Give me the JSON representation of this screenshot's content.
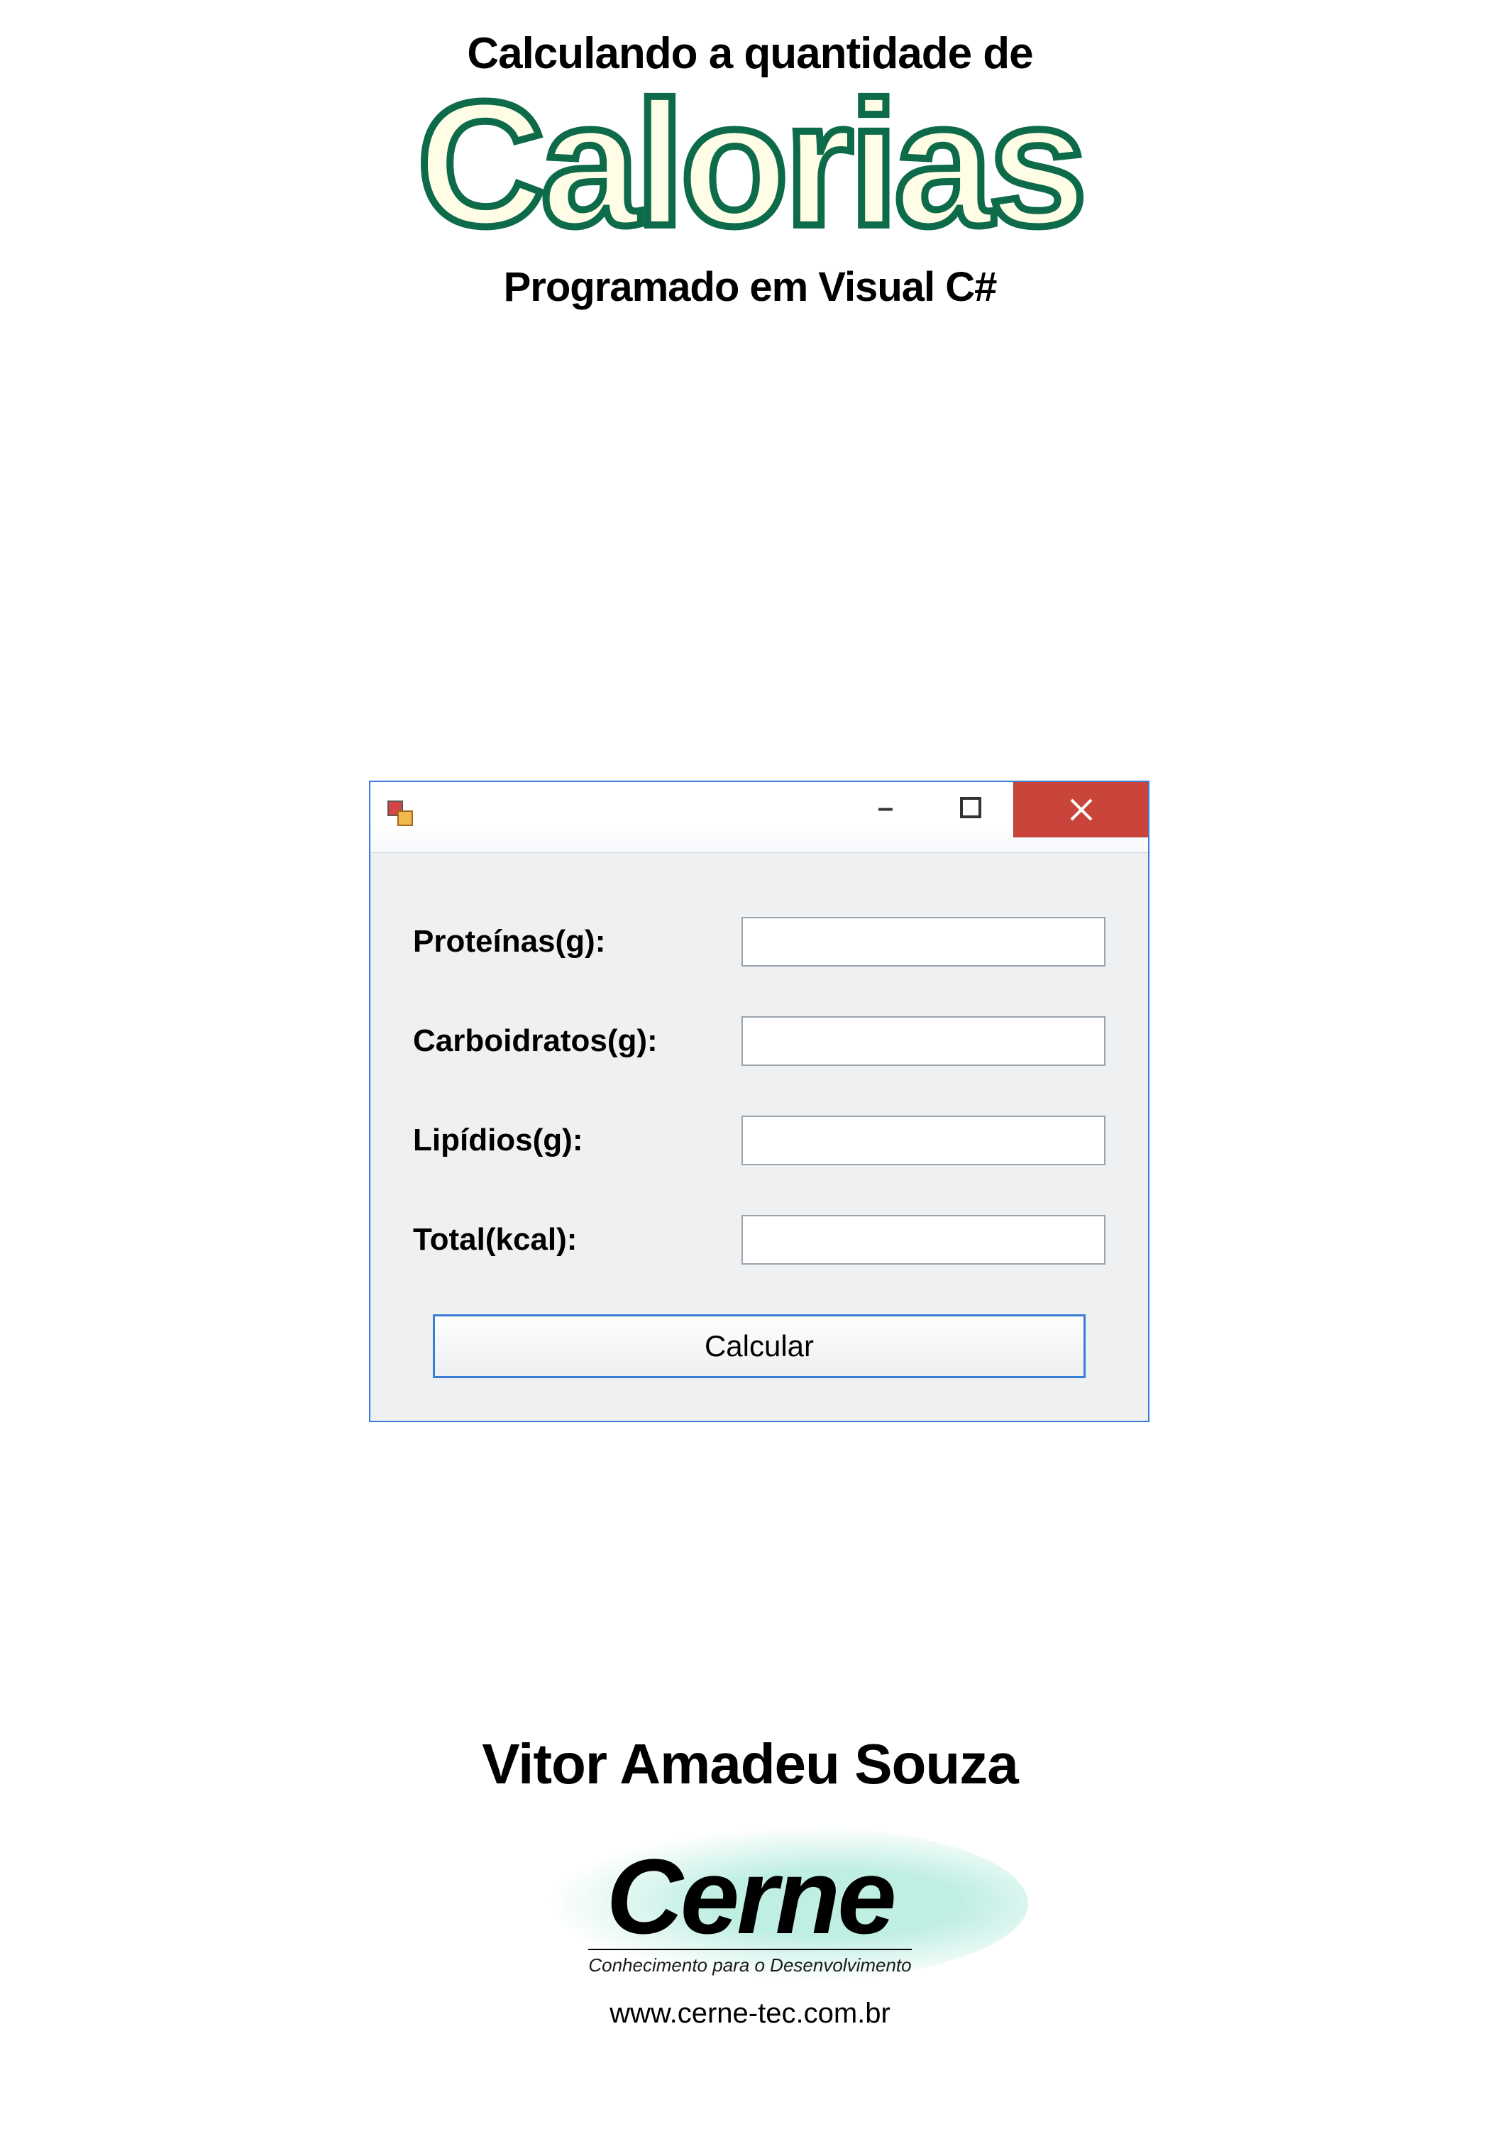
{
  "header": {
    "eyebrow": "Calculando a quantidade de",
    "title": "Calorias",
    "subtitle": "Programado em Visual C#"
  },
  "form": {
    "icon_name": "winforms-app-icon",
    "controls": {
      "minimize": "–",
      "maximize": "□",
      "close": "×"
    },
    "rows": [
      {
        "label": "Proteínas(g):",
        "value": ""
      },
      {
        "label": "Carboidratos(g):",
        "value": ""
      },
      {
        "label": "Lipídios(g):",
        "value": ""
      },
      {
        "label": "Total(kcal):",
        "value": ""
      }
    ],
    "button": "Calcular"
  },
  "footer": {
    "author": "Vitor Amadeu Souza",
    "brand": "Cerne",
    "tagline": "Conhecimento para o Desenvolvimento",
    "url": "www.cerne-tec.com.br"
  },
  "colors": {
    "title_stroke": "#0d6b4a",
    "title_fill": "#fffde6",
    "window_border": "#3a7dd6",
    "close_bg": "#c9453b",
    "panel_bg": "#eef0f2"
  }
}
